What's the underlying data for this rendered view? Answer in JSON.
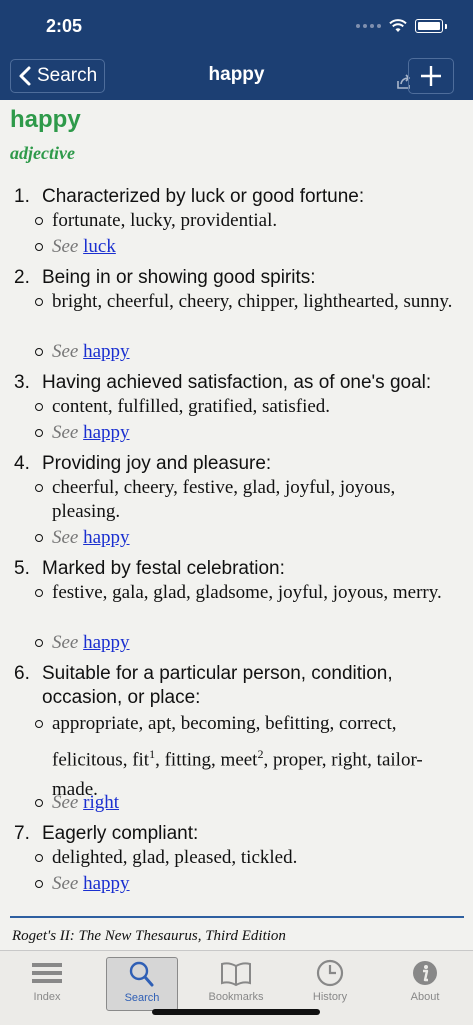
{
  "status": {
    "time": "2:05"
  },
  "nav": {
    "back_label": "Search",
    "title": "happy"
  },
  "entry": {
    "headword": "happy",
    "part_of_speech": "adjective",
    "see_word": "See",
    "senses": [
      {
        "num": "1.",
        "definition": "Characterized by luck or good fortune:",
        "synonyms": "fortunate, lucky, providential.",
        "see_link": "luck"
      },
      {
        "num": "2.",
        "definition": "Being in or showing good spirits:",
        "synonyms": "bright, cheerful, cheery, chipper, lighthearted, sunny.",
        "see_link": "happy"
      },
      {
        "num": "3.",
        "definition": "Having achieved satisfaction, as of one's goal:",
        "synonyms": "content, fulfilled, gratified, satisfied.",
        "see_link": "happy"
      },
      {
        "num": "4.",
        "definition": "Providing joy and pleasure:",
        "synonyms": "cheerful, cheery, festive, glad, joyful, joyous, pleasing.",
        "see_link": "happy"
      },
      {
        "num": "5.",
        "definition": "Marked by festal celebration:",
        "synonyms": "festive, gala, glad, gladsome, joyful, joyous, merry.",
        "see_link": "happy"
      },
      {
        "num": "6.",
        "definition": "Suitable for a particular person, condition, occasion, or place:",
        "synonyms_a": "appropriate, apt, becoming, befitting, correct, felicitous, fit",
        "sup1": "1",
        "synonyms_b": ", fitting, meet",
        "sup2": "2",
        "synonyms_c": ", proper, right, tailor-made.",
        "see_link": "right"
      },
      {
        "num": "7.",
        "definition": "Eagerly compliant:",
        "synonyms": "delighted, glad, pleased, tickled.",
        "see_link": "happy"
      }
    ],
    "source": "Roget's II: The New Thesaurus, Third Edition"
  },
  "tabs": [
    {
      "label": "Index",
      "icon": "list-icon"
    },
    {
      "label": "Search",
      "icon": "magnifier-icon",
      "active": true
    },
    {
      "label": "Bookmarks",
      "icon": "book-icon"
    },
    {
      "label": "History",
      "icon": "clock-icon"
    },
    {
      "label": "About",
      "icon": "info-icon"
    }
  ],
  "colors": {
    "nav_bar": "#1c3f73",
    "headword": "#2e9a4a",
    "link": "#1a2fd0",
    "active_tab": "#2f5fb5",
    "divider": "#2e5fa0"
  }
}
